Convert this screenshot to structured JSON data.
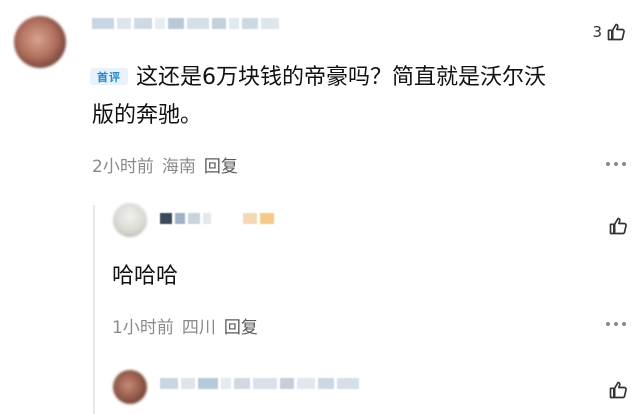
{
  "comment": {
    "badge": "首评",
    "text_line1": "这还是6万块钱的帝豪吗？简直就是沃尔沃",
    "text_line2": "版的奔驰。",
    "time": "2小时前",
    "location": "海南",
    "reply_label": "回复",
    "like_count": "3"
  },
  "replies": [
    {
      "text": "哈哈哈",
      "time": "1小时前",
      "location": "四川",
      "reply_label": "回复"
    }
  ],
  "icons": {
    "like": "thumbs-up-icon",
    "more": "more-dots-icon"
  },
  "colors": {
    "accent": "#1e8ad6",
    "meta_text": "#8a8a8a"
  }
}
